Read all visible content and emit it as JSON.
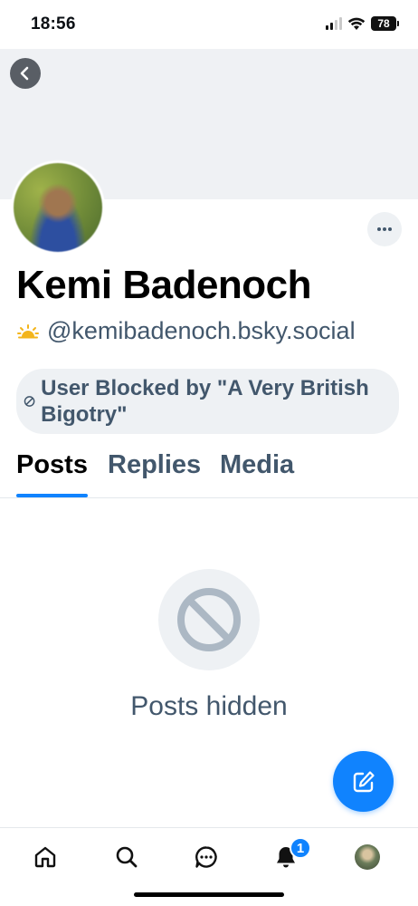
{
  "status_bar": {
    "time": "18:56",
    "battery": "78"
  },
  "profile": {
    "display_name": "Kemi Badenoch",
    "handle": "@kemibadenoch.bsky.social",
    "blocked_label": "User Blocked by \"A Very British Bigotry\""
  },
  "tabs": [
    {
      "label": "Posts",
      "active": true
    },
    {
      "label": "Replies",
      "active": false
    },
    {
      "label": "Media",
      "active": false
    }
  ],
  "empty_state": {
    "text": "Posts hidden"
  },
  "bottom_nav": {
    "notification_count": "1"
  },
  "colors": {
    "accent": "#1083fe",
    "muted_text": "#42576c",
    "banner": "#eff1f4"
  },
  "icons": [
    "back-icon",
    "more-icon",
    "sun-icon",
    "blocked-icon",
    "no-entry-icon",
    "compose-icon",
    "home-icon",
    "search-icon",
    "chat-icon",
    "bell-icon"
  ]
}
